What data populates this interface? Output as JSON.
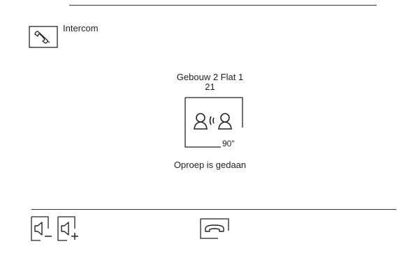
{
  "header": {
    "title": "Intercom",
    "icon": "handset-icon"
  },
  "call": {
    "name": "Gebouw 2 Flat 1",
    "number": "21",
    "timer": "90\"",
    "status": "Oproep is gedaan",
    "icon": "intercom-call-icon"
  },
  "controls": {
    "volume_down_icon": "volume-down-icon",
    "volume_up_icon": "volume-up-icon",
    "hangup_icon": "hangup-icon"
  },
  "colors": {
    "foreground": "#1e1e1e",
    "background": "#ffffff"
  }
}
